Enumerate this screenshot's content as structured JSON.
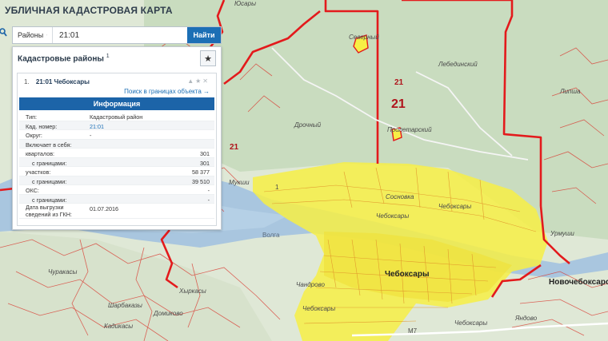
{
  "app": {
    "title": "УБЛИЧНАЯ КАДАСТРОВАЯ КАРТА"
  },
  "search": {
    "type_label": "Районы",
    "value": "21:01",
    "clear": "×",
    "button": "Найти"
  },
  "panel": {
    "title": "Кадастровые районы",
    "count": "1",
    "star": "★",
    "item": {
      "index": "1.",
      "name": "21:01 Чебоксары",
      "link": "Поиск в границах объекта →"
    },
    "info_title": "Информация",
    "rows": [
      {
        "key": "Тип:",
        "value": "Кадастровый район"
      },
      {
        "key": "Кад. номер:",
        "value": "21:01"
      },
      {
        "key": "Округ:",
        "value": "-"
      },
      {
        "key": "Включает в себя:",
        "value": ""
      },
      {
        "key": "кварталов:",
        "value": "301"
      },
      {
        "key": "с границами:",
        "value": "301"
      },
      {
        "key": "участков:",
        "value": "58 377"
      },
      {
        "key": "с границами:",
        "value": "39 510"
      },
      {
        "key": "ОКС:",
        "value": "-"
      },
      {
        "key": "с границами:",
        "value": "-"
      },
      {
        "key": "Дата выгрузки сведений из ГКН:",
        "value": "01.07.2016"
      }
    ]
  },
  "map_labels": {
    "yusary": "Юсары",
    "severny": "Северный",
    "lebedinsky": "Лебединский",
    "num21_a": "21",
    "num21_b": "21",
    "num21_c": "21",
    "lipsha": "Липша",
    "dronochny": "Дрочный",
    "proletarsky": "Пролетарский",
    "mukhino": "Мукши",
    "sosnovka": "Сосновка",
    "cheb_top": "Чебоксары",
    "cheb_mid": "Чебоксары",
    "volga": "Волга",
    "urmushi": "Урмуши",
    "curakasy": "Чуракасы",
    "cheboksary_city": "Чебоксары",
    "novocheb": "Новочебоксарс",
    "chandrovo": "Чандрово",
    "khyrkasy": "Хыркасы",
    "sharbakasy": "Шарбаказы",
    "domikovo": "Домиково",
    "kadikasy": "Кадикасы",
    "cheb_bottom_a": "Чебоксары",
    "cheb_bottom_b": "Чебоксары",
    "m7": "М7",
    "yandovo": "Яндово",
    "cheb_dist": "1"
  },
  "colors": {
    "accent": "#1c64a8",
    "boundary": "#e31a1c",
    "city_fill": "#f7ef45",
    "water": "#a9c6df"
  }
}
